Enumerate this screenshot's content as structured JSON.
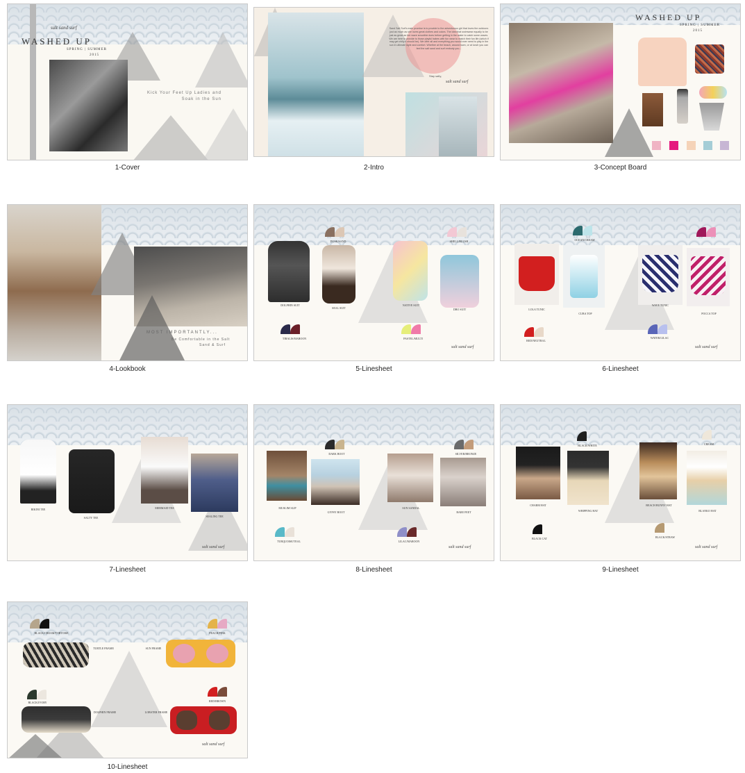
{
  "pages": [
    {
      "caption": "1-Cover"
    },
    {
      "caption": "2-Intro"
    },
    {
      "caption": "3-Concept Board"
    },
    {
      "caption": "4-Lookbook"
    },
    {
      "caption": "5-Linesheet"
    },
    {
      "caption": "6-Linesheet"
    },
    {
      "caption": "7-Linesheet"
    },
    {
      "caption": "8-Linesheet"
    },
    {
      "caption": "9-Linesheet"
    },
    {
      "caption": "10-Linesheet"
    }
  ],
  "brand": {
    "collection_title": "WASHED UP",
    "season": "SPRING | SUMMER",
    "year": "2015",
    "logo_text": "salt sand surf"
  },
  "cover": {
    "tagline": "Kick Your Feet Up Ladies and Soak in the Sun"
  },
  "intro": {
    "body": "Sand Salt Surf's main promise is to provide to the adventurous girl that loves the outdoors just as much as she loves great clothes and colors. The idea that swimwear equally to be just as great as her wave smoothie does before getting in the water to catch some waves. We are here to provide to those playful babes with fun wear to match their fun life (which if may get chilly it should be). We offer all and everything you would ever need to play in the sun in ultimate style and comfort. Whether at the beach, around town, or at lunch you can feel the salt sand and surf embody you...",
    "signoff": "Stay salty,"
  },
  "concept": {
    "colors": [
      "#f0b4c4",
      "#e5197e",
      "#f5d3b8",
      "#a5cdd6",
      "#c7b6d4"
    ]
  },
  "lookbook": {
    "line1": "MOST IMPORTANTLY...",
    "line2": "Be Comfortable in the Salt",
    "line3": "Sand & Surf"
  },
  "sheet5": {
    "products": [
      "DOLPHIN SUIT",
      "SEAL SUIT",
      "NATIVE SUIT",
      "DBO SUIT"
    ],
    "color_labels": [
      "DUSK/SAND",
      "TIBALIS/MAROON",
      "SHELL/BLUSH",
      "PASTEL/MULTI"
    ]
  },
  "sheet6": {
    "products": [
      "LOLA TUNIC",
      "CUBA TOP",
      "WAVE TUNIC",
      "POCCA TOP"
    ],
    "color_labels": [
      "OCEAN/CREAM",
      "RED/NEUTRAL",
      "NAVY/WHITE",
      "WATER/LILAC"
    ]
  },
  "sheet7": {
    "products": [
      "BIKINI TEE",
      "SALTY TEE",
      "MERMAID TEE",
      "SEALING TEE"
    ]
  },
  "sheet8": {
    "products": [
      "MUSLIM SLIP",
      "GYPSY BOOT",
      "SUN SANDAL",
      "BARE FEET"
    ],
    "color_labels": [
      "DARK BOOT",
      "SILVER/BRONZE",
      "TURQUOISE/TEAL",
      "LILAC/MAROON"
    ]
  },
  "sheet9": {
    "products": [
      "CHARM HAT",
      "WHIPPING HAT",
      "BEACH BUNNY HAT",
      "BLANKO HAT"
    ],
    "color_labels": [
      "BLACK/WHITE",
      "CREAM",
      "BLACK CAT",
      "BLACK/STRAW"
    ]
  },
  "sheet10": {
    "products": [
      "TURTLE FRAME",
      "SUN FRAME",
      "DOLPHIN FRAME",
      "LOBSTER FRAME"
    ],
    "color_labels": [
      "BLACK/CREAM/TORTOISE",
      "PEACH/PINK",
      "BLACK/IVORY",
      "RED/BROWN"
    ]
  }
}
